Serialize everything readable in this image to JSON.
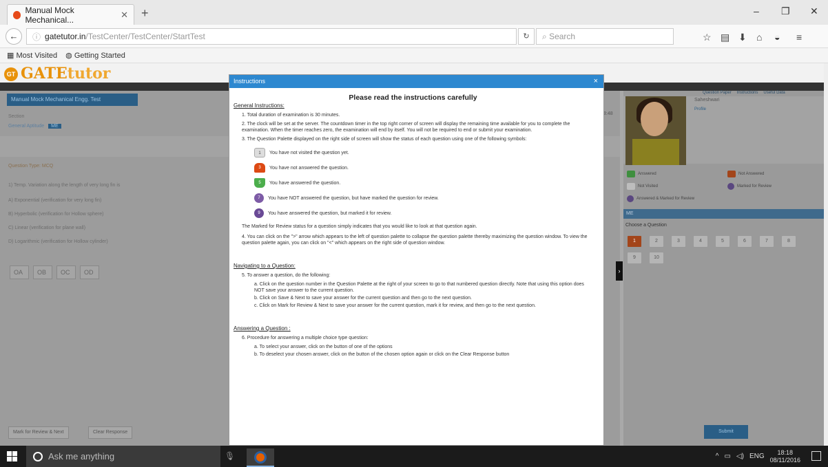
{
  "browser": {
    "tab_title": "Manual Mock Mechanical...",
    "url_host": "gatetutor.in",
    "url_path": "/TestCenter/TestCenter/StartTest",
    "search_placeholder": "Search",
    "bookmarks": [
      "Most Visited",
      "Getting Started"
    ]
  },
  "site": {
    "logo_main": "GATE",
    "logo_sub": "tutor",
    "logo_badge": "GT",
    "test_title": "Manual Mock Mechanical Engg. Test",
    "section_label": "Section",
    "sections": [
      "General Aptitude",
      "ME"
    ],
    "question_type": "Question Type: MCQ",
    "question_text": "1) Temp. Variation along the length of very long fin is",
    "options": [
      "A) Exponential (verification for very long fin)",
      "B) Hyperbolic (verification for Hollow sphere)",
      "C) Linear (verification for plane wall)",
      "D) Logarithmic (verification for Hollow cylinder)"
    ],
    "option_buttons": [
      "A",
      "B",
      "C",
      "D"
    ],
    "mark_review_button": "Mark for Review & Next",
    "clear_response_button": "Clear Response",
    "submit_button": "Submit",
    "top_links": [
      "Question Paper",
      "Instructions",
      "Useful Data"
    ],
    "candidate_name": "Saheshwari",
    "profile_link": "Profile",
    "legend": [
      "Answered",
      "Not Answered",
      "Not Visited",
      "Marked for Review",
      "Answered & Marked for Review"
    ],
    "palette_section": "ME",
    "choose_question": "Choose a Question",
    "question_numbers": [
      "1",
      "2",
      "3",
      "4",
      "5",
      "6",
      "7",
      "8",
      "9",
      "10"
    ],
    "timer_partial": "8:48"
  },
  "modal": {
    "header": "Instructions",
    "title": "Please read the instructions carefully",
    "general_heading": "General Instructions:",
    "items": [
      "1. Total duration of examination is 30 minutes.",
      "2. The clock will be set at the server. The countdown timer in the top right corner of screen will display the remaining time available for you to complete the examination. When the timer reaches zero, the examination will end by itself. You will not be required to end or submit your examination.",
      "3. The Question Palette displayed on the right side of screen will show the status of each question using one of the following symbols:"
    ],
    "palette_legend": [
      {
        "icon": "1",
        "text": "You have not visited the question yet."
      },
      {
        "icon": "3",
        "text": "You have not answered the question."
      },
      {
        "icon": "5",
        "text": "You have answered the question."
      },
      {
        "icon": "7",
        "text": "You have NOT answered the question, but have marked the question for review."
      },
      {
        "icon": "9",
        "text": "You have answered the question, but marked it for review."
      }
    ],
    "review_note": "The Marked for Review status for a question simply indicates that you would like to look at that question again.",
    "item4": "4. You can click on the \">\" arrow which appears to the left of question palette to collapse the question palette thereby maximizing the question window. To view the question palette again, you can click on \"<\" which appears on the right side of question window.",
    "navigating_heading": "Navigating to a Question:",
    "item5": "5. To answer a question, do the following:",
    "item5_sub": [
      "a. Click on the question number in the Question Palette at the right of your screen to go to that numbered question directly. Note that using this option does NOT save your answer to the current question.",
      "b. Click on Save & Next to save your answer for the current question and then go to the next question.",
      "c. Click on Mark for Review & Next to save your answer for the current question, mark it for review, and then go to the next question."
    ],
    "answering_heading": "Answering a Question :",
    "item6": "6. Procedure for answering a multiple choice type question:",
    "item6_sub": [
      "a. To select your answer, click on the button of one of the options",
      "b. To deselect your chosen answer, click on the button of the chosen option again or click on the Clear Response button"
    ],
    "close_glyph": "×"
  },
  "taskbar": {
    "cortana": "Ask me anything",
    "lang": "ENG",
    "time": "18:18",
    "date": "08/11/2016"
  },
  "colors": {
    "modal_header": "#2d88d0",
    "accent_orange": "#e8920b",
    "not_answered": "#dd4a14",
    "answered": "#4cae4c",
    "marked": "#7d5ba6"
  }
}
